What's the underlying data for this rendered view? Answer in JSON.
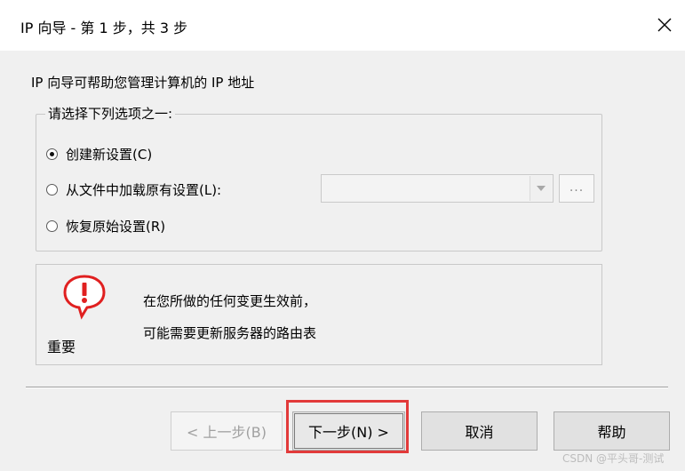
{
  "window": {
    "title": "IP 向导 - 第 1 步，共 3 步",
    "close_glyph": "✕"
  },
  "intro_text": "IP 向导可帮助您管理计算机的 IP 地址",
  "options_group": {
    "legend": "请选择下列选项之一:",
    "options": [
      {
        "label": "创建新设置(C)",
        "checked": true
      },
      {
        "label": "从文件中加载原有设置(L):",
        "checked": false
      },
      {
        "label": "恢复原始设置(R)",
        "checked": false
      }
    ],
    "file_combo_value": "",
    "browse_label": "..."
  },
  "warning": {
    "icon": "warning-speech-bubble-icon",
    "title": "重要",
    "line1": "在您所做的任何变更生效前，",
    "line2": "可能需要更新服务器的路由表"
  },
  "buttons": {
    "back": "< 上一步(B)",
    "next": "下一步(N) >",
    "cancel": "取消",
    "help": "帮助"
  },
  "colors": {
    "dialog_bg": "#f0f0f0",
    "highlight": "#e23a3a",
    "warning_icon": "#e02020"
  },
  "watermark": "CSDN @平头哥-测试"
}
